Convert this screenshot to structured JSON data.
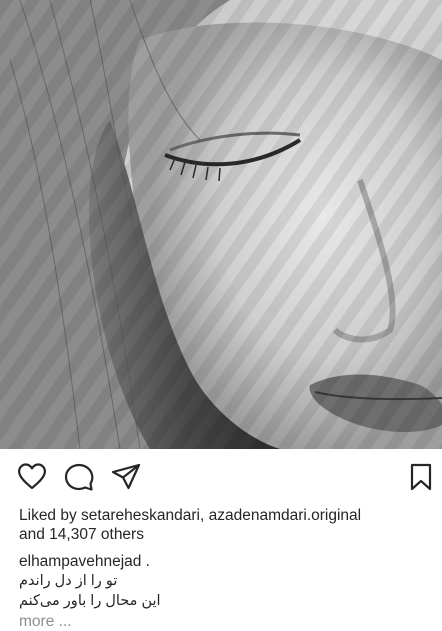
{
  "post": {
    "photo": {
      "icon": "portrait-photo"
    },
    "actions": {
      "like_icon": "heart-icon",
      "comment_icon": "comment-icon",
      "share_icon": "share-icon",
      "save_icon": "bookmark-icon"
    },
    "likes": {
      "prefix": "Liked by ",
      "user1": "setareheskandari",
      "separator": ", ",
      "user2": "azadenamdari.original",
      "and_text": "and ",
      "others": "14,307 others"
    },
    "caption": {
      "username": "elhampavehnejad",
      "dot": " .",
      "line1": "تو را از دل راندم",
      "line2": "این محال را باور می‌کنم",
      "more": "more ..."
    }
  },
  "colors": {
    "text": "#262626",
    "muted": "#8e8e8e",
    "background": "#ffffff"
  }
}
